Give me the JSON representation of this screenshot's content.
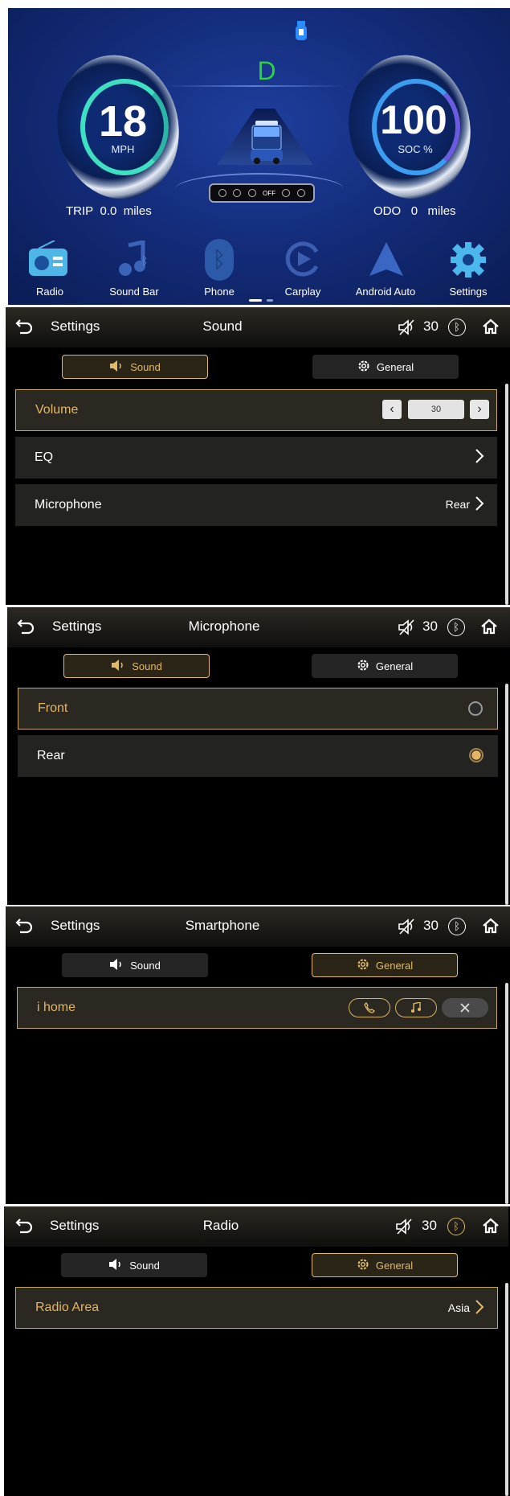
{
  "dashboard": {
    "gear": "D",
    "speed": "18",
    "speed_unit": "MPH",
    "soc": "100",
    "soc_unit": "SOC %",
    "trip_label": "TRIP",
    "trip_value": "0.0",
    "trip_unit": "miles",
    "odo_label": "ODO",
    "odo_value": "0",
    "odo_unit": "miles",
    "indicator_label": "OFF",
    "apps": [
      {
        "label": "Radio",
        "icon": "radio-icon",
        "color": "#4fb6e8"
      },
      {
        "label": "Sound Bar",
        "icon": "music-note-bluetooth-icon",
        "color": "#3b63b8"
      },
      {
        "label": "Phone",
        "icon": "bluetooth-icon",
        "color": "#2c5aa8"
      },
      {
        "label": "Carplay",
        "icon": "carplay-icon",
        "color": "#3d5db0"
      },
      {
        "label": "Android Auto",
        "icon": "android-auto-icon",
        "color": "#3a66c4"
      },
      {
        "label": "Settings",
        "icon": "gear-icon",
        "color": "#4cb7ec"
      }
    ]
  },
  "colors": {
    "accent": "#e0b96a",
    "row_bg": "#232321",
    "selected_dot": "#e5b563"
  },
  "screens": [
    {
      "back_label": "Settings",
      "title": "Sound",
      "volume": "30",
      "tab_sound": "Sound",
      "tab_general": "General",
      "volume_row": {
        "label": "Volume",
        "value": "30"
      },
      "eq_row": {
        "label": "EQ"
      },
      "mic_row": {
        "label": "Microphone",
        "value": "Rear"
      }
    },
    {
      "back_label": "Settings",
      "title": "Microphone",
      "volume": "30",
      "tab_sound": "Sound",
      "tab_general": "General",
      "options": [
        {
          "label": "Front",
          "selected": false
        },
        {
          "label": "Rear",
          "selected": true
        }
      ]
    },
    {
      "back_label": "Settings",
      "title": "Smartphone",
      "volume": "30",
      "tab_sound": "Sound",
      "tab_general": "General",
      "device": {
        "label": "i home"
      }
    },
    {
      "back_label": "Settings",
      "title": "Radio",
      "volume": "30",
      "tab_sound": "Sound",
      "tab_general": "General",
      "radio_area": {
        "label": "Radio Area",
        "value": "Asia"
      }
    }
  ]
}
